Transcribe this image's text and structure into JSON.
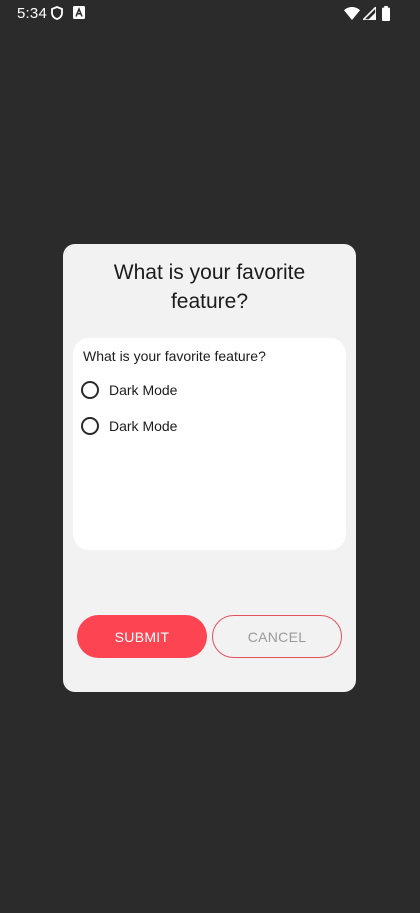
{
  "status_bar": {
    "time": "5:34",
    "left_icons": [
      "shield-icon",
      "a-box-icon"
    ],
    "right_icons": [
      "wifi-icon",
      "signal-icon",
      "battery-icon"
    ]
  },
  "dialog": {
    "title": "What is your favorite feature?",
    "question": {
      "label": "What is your favorite feature?",
      "options": [
        {
          "label": "Dark Mode",
          "selected": false
        },
        {
          "label": "Dark Mode",
          "selected": false
        }
      ]
    },
    "submit_label": "SUBMIT",
    "cancel_label": "CANCEL"
  },
  "colors": {
    "background": "#2b2b2b",
    "dialog_bg": "#f2f2f2",
    "accent": "#fc4452"
  }
}
